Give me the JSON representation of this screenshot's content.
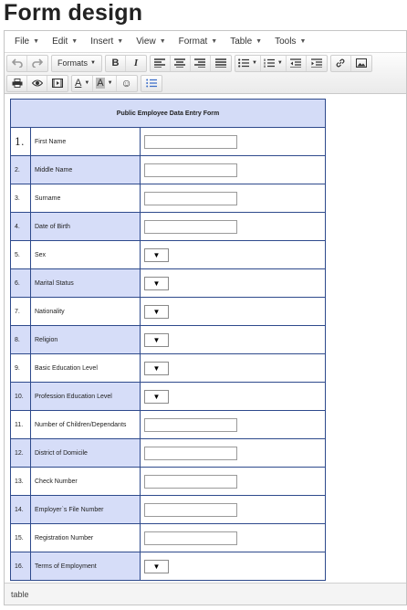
{
  "page": {
    "title": "Form design"
  },
  "menubar": {
    "items": [
      {
        "label": "File"
      },
      {
        "label": "Edit"
      },
      {
        "label": "Insert"
      },
      {
        "label": "View"
      },
      {
        "label": "Format"
      },
      {
        "label": "Table"
      },
      {
        "label": "Tools"
      }
    ]
  },
  "toolbar": {
    "formats_label": "Formats",
    "bold_label": "B",
    "italic_label": "I",
    "text_color_label": "A",
    "bg_color_label": "A",
    "emoji_glyph": "☺"
  },
  "form": {
    "heading": "Public Employee Data Entry Form",
    "rows": [
      {
        "num": "1.",
        "label": "First Name",
        "field": "text"
      },
      {
        "num": "2.",
        "label": "Middle Name",
        "field": "text"
      },
      {
        "num": "3.",
        "label": "Surname",
        "field": "text"
      },
      {
        "num": "4.",
        "label": "Date of Birth",
        "field": "text"
      },
      {
        "num": "5.",
        "label": "Sex",
        "field": "select"
      },
      {
        "num": "6.",
        "label": "Marital Status",
        "field": "select"
      },
      {
        "num": "7.",
        "label": "Nationality",
        "field": "select"
      },
      {
        "num": "8.",
        "label": "Religion",
        "field": "select"
      },
      {
        "num": "9.",
        "label": "Basic Education Level",
        "field": "select"
      },
      {
        "num": "10.",
        "label": "Profession Education Level",
        "field": "select"
      },
      {
        "num": "11.",
        "label": "Number of Children/Dependants",
        "field": "text"
      },
      {
        "num": "12.",
        "label": "District of Domicile",
        "field": "text"
      },
      {
        "num": "13.",
        "label": "Check Number",
        "field": "text"
      },
      {
        "num": "14.",
        "label": "Employer`s File Number",
        "field": "text"
      },
      {
        "num": "15.",
        "label": "Registration Number",
        "field": "text"
      },
      {
        "num": "16.",
        "label": "Terms of Employment",
        "field": "select"
      }
    ],
    "select_glyph": "▼"
  },
  "statusbar": {
    "path": "table"
  },
  "colors": {
    "row_shade": "#d6ddf8",
    "table_border": "#2e4a8c"
  }
}
